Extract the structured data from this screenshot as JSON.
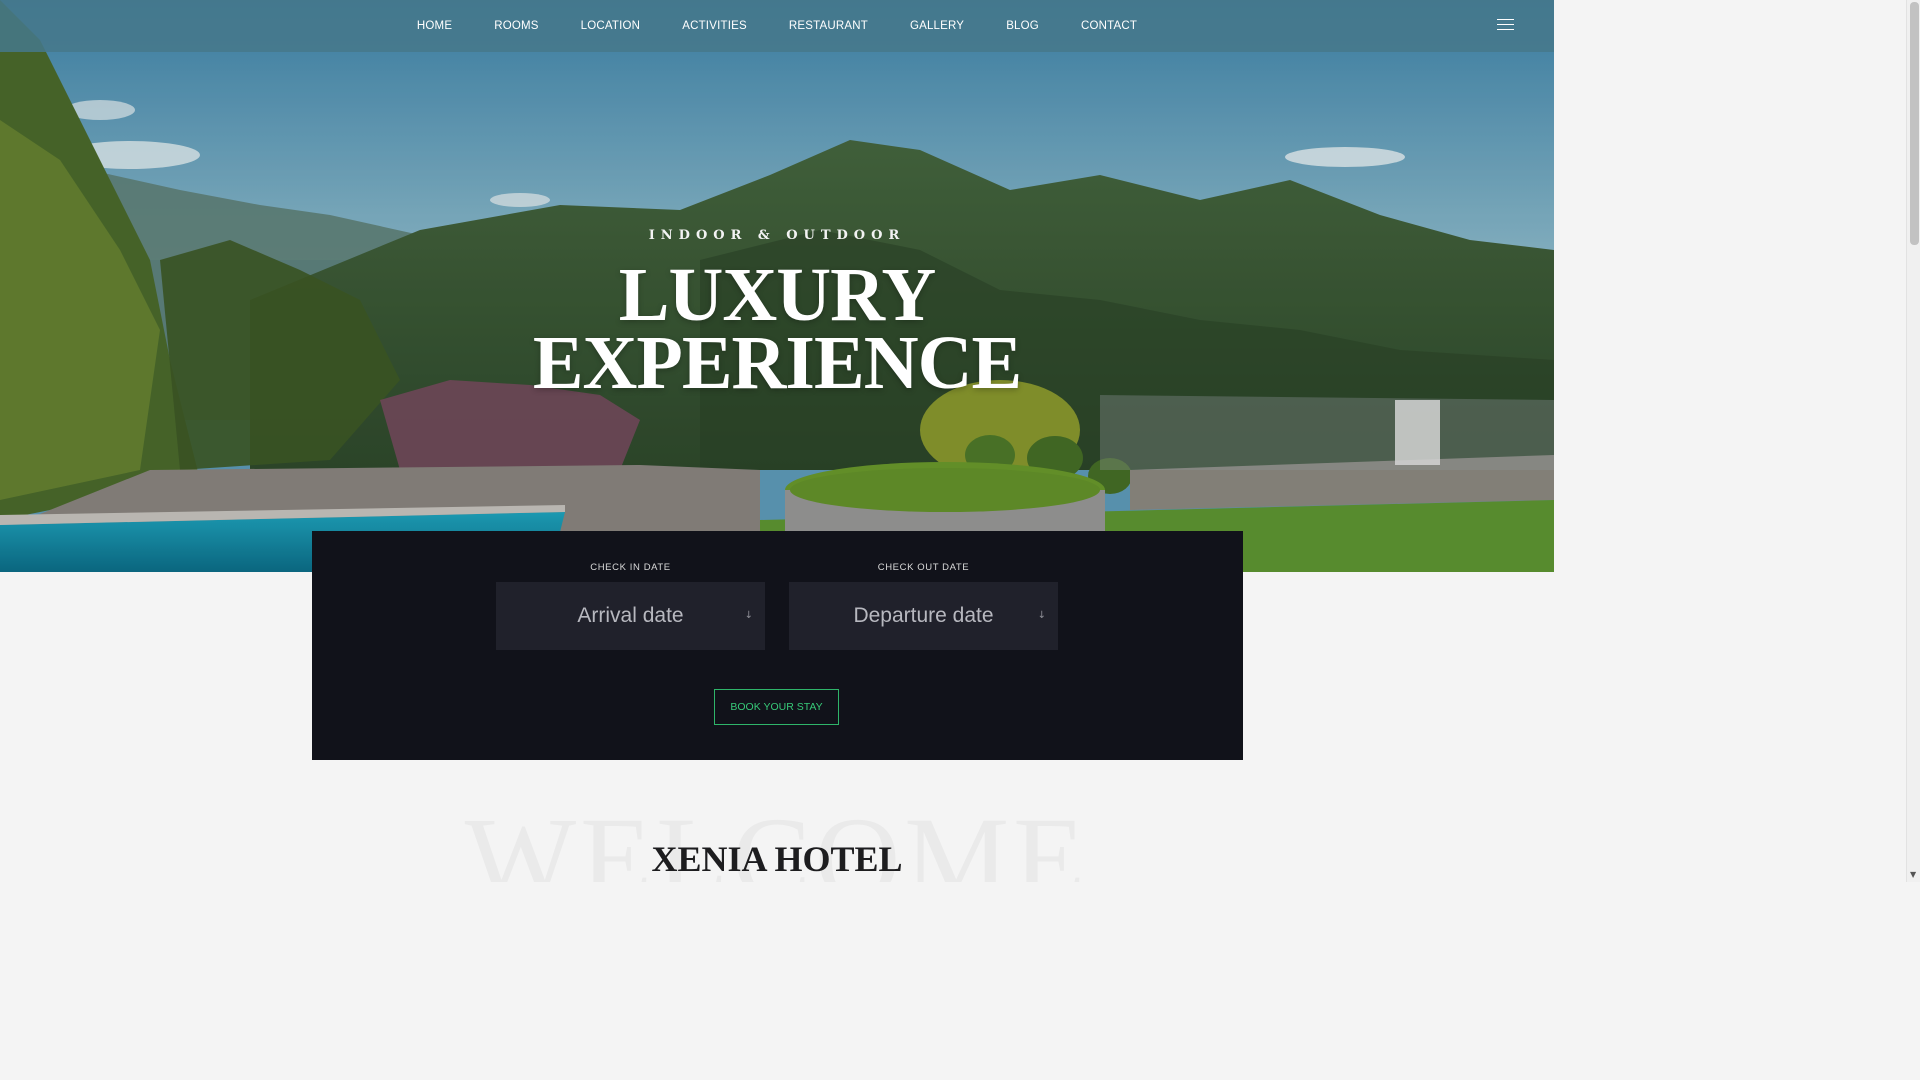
{
  "nav": {
    "links": [
      "HOME",
      "ROOMS",
      "LOCATION",
      "ACTIVITIES",
      "RESTAURANT",
      "GALLERY",
      "BLOG",
      "CONTACT"
    ],
    "menu_icon": "hamburger-menu-icon"
  },
  "hero": {
    "kicker": "INDOOR & OUTDOOR",
    "title_line1": "LUXURY",
    "title_line2": "EXPERIENCE"
  },
  "booking": {
    "checkin_label": "CHECK IN DATE",
    "checkin_placeholder": "Arrival date",
    "checkout_label": "CHECK OUT DATE",
    "checkout_placeholder": "Departure date",
    "button_label": "BOOK YOUR STAY",
    "arrow_icon": "chevron-down-icon"
  },
  "welcome": {
    "background_word": "WELCOME",
    "title": "XENIA HOTEL"
  },
  "colors": {
    "nav_bg": "#46788a",
    "panel_bg": "#11121a",
    "field_bg": "#20212b",
    "button_accent": "#37c978"
  }
}
